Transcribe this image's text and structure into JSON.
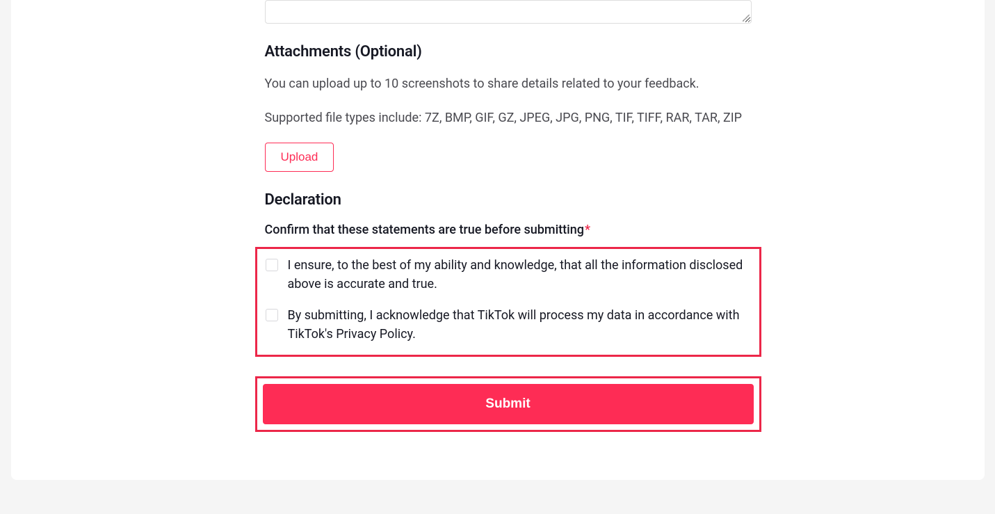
{
  "attachments": {
    "heading": "Attachments (Optional)",
    "help_line1": "You can upload up to 10 screenshots to share details related to your feedback.",
    "help_line2": "Supported file types include: 7Z, BMP, GIF, GZ, JPEG, JPG, PNG, TIF, TIFF, RAR, TAR, ZIP",
    "upload_label": "Upload"
  },
  "declaration": {
    "heading": "Declaration",
    "confirm_label": "Confirm that these statements are true before submitting",
    "checkbox1": "I ensure, to the best of my ability and knowledge, that all the information disclosed above is accurate and true.",
    "checkbox2": "By submitting, I acknowledge that TikTok will process my data in accordance with TikTok's Privacy Policy."
  },
  "submit": {
    "label": "Submit"
  }
}
